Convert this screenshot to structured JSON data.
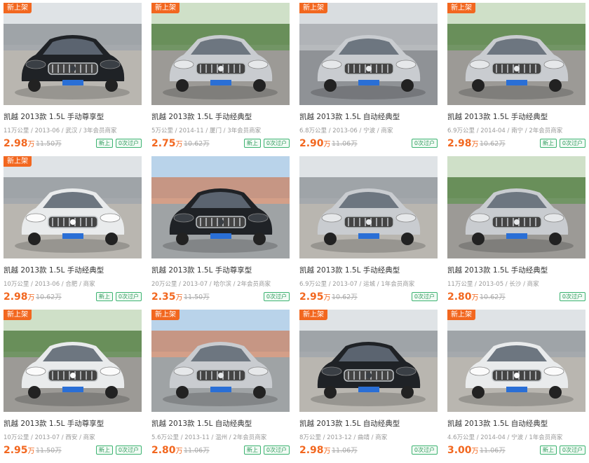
{
  "colors": {
    "accent": "#f2671f",
    "tag": "#3cb371",
    "title": "#333333",
    "meta": "#999999"
  },
  "listings": [
    {
      "badge": "新上架",
      "title": "凯越 2013款 1.5L 手动尊享型",
      "meta": "11万公里 / 2013-06 / 武汉 / 3年会员商家",
      "price": "2.98",
      "unit": "万",
      "orig": "11.50万",
      "tags": [
        "新上",
        "0次过户"
      ],
      "car_color": "black",
      "bg": "lot"
    },
    {
      "badge": "新上架",
      "title": "凯越 2013款 1.5L 手动经典型",
      "meta": "5万公里 / 2014-11 / 厦门 / 3年会员商家",
      "price": "2.75",
      "unit": "万",
      "orig": "10.62万",
      "tags": [
        "新上",
        "0次过户"
      ],
      "car_color": "silver",
      "bg": "trees"
    },
    {
      "badge": "新上架",
      "title": "凯越 2013款 1.5L 自动经典型",
      "meta": "6.8万公里 / 2013-06 / 宁波 / 商家",
      "price": "2.90",
      "unit": "万",
      "orig": "11.06万",
      "tags": [
        "0次过户"
      ],
      "car_color": "silver",
      "bg": "road"
    },
    {
      "badge": "新上架",
      "title": "凯越 2013款 1.5L 手动经典型",
      "meta": "6.9万公里 / 2014-04 / 南宁 / 2年会员商家",
      "price": "2.98",
      "unit": "万",
      "orig": "10.62万",
      "tags": [
        "新上",
        "0次过户"
      ],
      "car_color": "silver",
      "bg": "trees"
    },
    {
      "badge": "新上架",
      "title": "凯越 2013款 1.5L 手动经典型",
      "meta": "10万公里 / 2013-06 / 合肥 / 商家",
      "price": "2.98",
      "unit": "万",
      "orig": "10.62万",
      "tags": [
        "新上",
        "0次过户"
      ],
      "car_color": "white",
      "bg": "lot"
    },
    {
      "badge": "",
      "title": "凯越 2013款 1.5L 手动尊享型",
      "meta": "20万公里 / 2013-07 / 哈尔滨 / 2年会员商家",
      "price": "2.35",
      "unit": "万",
      "orig": "11.50万",
      "tags": [
        "0次过户"
      ],
      "car_color": "black",
      "bg": "street"
    },
    {
      "badge": "",
      "title": "凯越 2013款 1.5L 手动经典型",
      "meta": "6.9万公里 / 2013-07 / 运城 / 1年会员商家",
      "price": "2.95",
      "unit": "万",
      "orig": "10.62万",
      "tags": [
        "0次过户"
      ],
      "car_color": "silver",
      "bg": "lot"
    },
    {
      "badge": "",
      "title": "凯越 2013款 1.5L 手动经典型",
      "meta": "11万公里 / 2013-05 / 长沙 / 商家",
      "price": "2.80",
      "unit": "万",
      "orig": "10.62万",
      "tags": [
        "0次过户"
      ],
      "car_color": "silver",
      "bg": "trees"
    },
    {
      "badge": "新上架",
      "title": "凯越 2013款 1.5L 手动尊享型",
      "meta": "10万公里 / 2013-07 / 西安 / 商家",
      "price": "2.95",
      "unit": "万",
      "orig": "11.50万",
      "tags": [
        "新上",
        "0次过户"
      ],
      "car_color": "white",
      "bg": "trees"
    },
    {
      "badge": "新上架",
      "title": "凯越 2013款 1.5L 自动经典型",
      "meta": "5.6万公里 / 2013-11 / 温州 / 2年会员商家",
      "price": "2.80",
      "unit": "万",
      "orig": "11.06万",
      "tags": [
        "新上",
        "0次过户"
      ],
      "car_color": "silver",
      "bg": "street"
    },
    {
      "badge": "新上架",
      "title": "凯越 2013款 1.5L 自动经典型",
      "meta": "8万公里 / 2013-12 / 曲靖 / 商家",
      "price": "2.98",
      "unit": "万",
      "orig": "11.06万",
      "tags": [
        "0次过户"
      ],
      "car_color": "black",
      "bg": "lot"
    },
    {
      "badge": "新上架",
      "title": "凯越 2013款 1.5L 自动经典型",
      "meta": "4.6万公里 / 2014-04 / 宁波 / 1年会员商家",
      "price": "3.00",
      "unit": "万",
      "orig": "11.06万",
      "tags": [
        "新上",
        "0次过户"
      ],
      "car_color": "white",
      "bg": "lot"
    }
  ]
}
